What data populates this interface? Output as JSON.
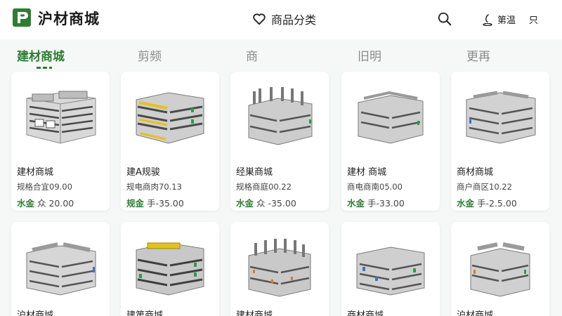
{
  "header": {
    "title": "沪材商城",
    "category_label": "商品分类",
    "user_label": "第温",
    "more_label": "只"
  },
  "tabs": [
    {
      "label": "建材商城"
    },
    {
      "label": "剪频"
    },
    {
      "label": "商"
    },
    {
      "label": "旧明"
    },
    {
      "label": "更再"
    }
  ],
  "products": [
    {
      "name": "建材商城",
      "spec": "规格合宜09.00",
      "price_tag": "水金",
      "price": "众 20.00"
    },
    {
      "name": "建A规骏",
      "spec": "规电商肉70.13",
      "price_tag": "规金",
      "price": "手-35.00"
    },
    {
      "name": "经巣商城",
      "spec": "规格商庭00.22",
      "price_tag": "水金",
      "price": "众 -35.00"
    },
    {
      "name": "建材 商城",
      "spec": "商电商南05.00",
      "price_tag": "水金",
      "price": "手-33.00"
    },
    {
      "name": "商材商城",
      "spec": "商户商区10.22",
      "price_tag": "水金",
      "price": "手-2.5.00"
    },
    {
      "name": "沪材商城",
      "spec": "",
      "price_tag": "",
      "price": ""
    },
    {
      "name": "建第商城",
      "spec": "",
      "price_tag": "",
      "price": ""
    },
    {
      "name": "建材商城",
      "spec": "",
      "price_tag": "",
      "price": ""
    },
    {
      "name": "商材商城",
      "spec": "",
      "price_tag": "",
      "price": ""
    },
    {
      "name": "沪材商城",
      "spec": "",
      "price_tag": "",
      "price": ""
    }
  ],
  "colors": {
    "brand": "#2e7d32",
    "accent_yellow": "#e4c21c",
    "accent_blue": "#3a76c7",
    "accent_orange": "#e07a22"
  },
  "icons": [
    "logo-icon",
    "heart-icon",
    "search-icon",
    "user-icon"
  ]
}
